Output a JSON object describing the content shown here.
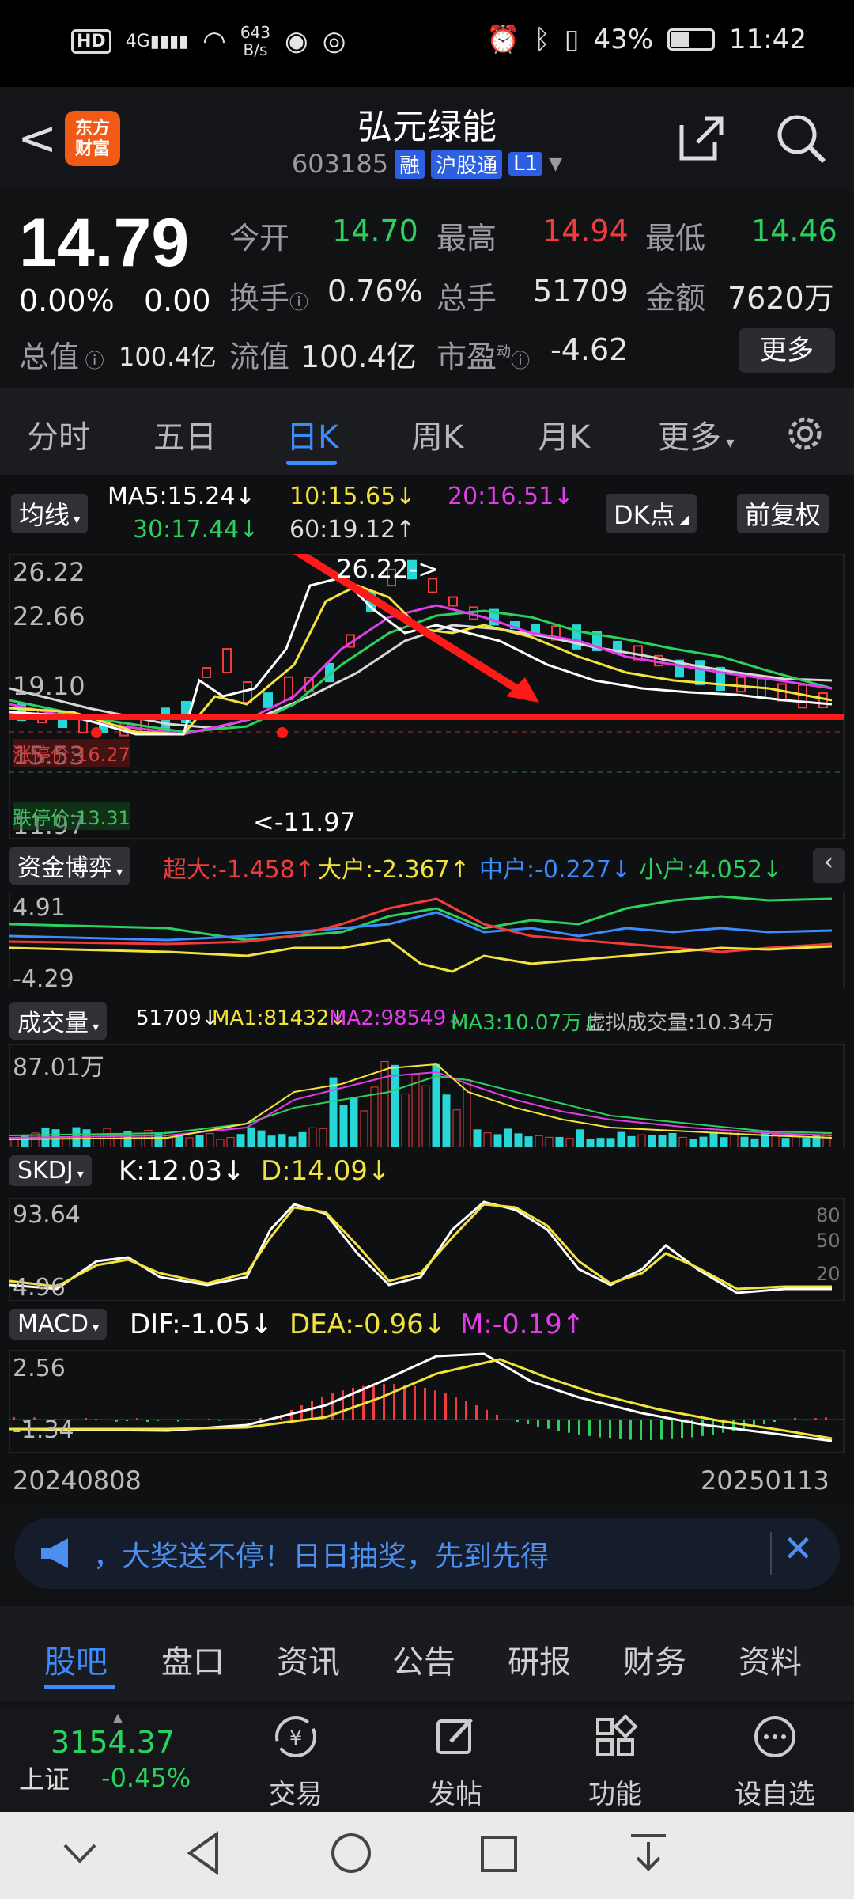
{
  "status": {
    "network": "4G",
    "speed_value": "643",
    "speed_unit": "B/s",
    "battery": "43%",
    "time": "11:42"
  },
  "header": {
    "back_label": "<",
    "logo_line1": "东方",
    "logo_line2": "财富",
    "title": "弘元绿能",
    "code": "603185",
    "tag_rong": "融",
    "tag_hgt": "沪股通",
    "tag_l1": "L1"
  },
  "quote": {
    "price": "14.79",
    "change_pct": "0.00%",
    "change": "0.00",
    "open_label": "今开",
    "open_value": "14.70",
    "high_label": "最高",
    "high_value": "14.94",
    "low_label": "最低",
    "low_value": "14.46",
    "turnover_label": "换手",
    "turnover_value": "0.76%",
    "volume_label": "总手",
    "volume_value": "51709",
    "amount_label": "金额",
    "amount_value": "7620万",
    "total_mv_label": "总值",
    "total_mv_value": "100.4亿",
    "float_mv_label": "流值",
    "float_mv_value": "100.4亿",
    "pe_label": "市盈",
    "pe_sup": "动",
    "pe_value": "-4.62",
    "more_label": "更多"
  },
  "tabs": {
    "items": [
      "分时",
      "五日",
      "日K",
      "周K",
      "月K",
      "更多"
    ],
    "active": "日K"
  },
  "kline": {
    "indicator_label": "均线",
    "ma5": "MA5:15.24↓",
    "ma10": "10:15.65↓",
    "ma20": "20:16.51↓",
    "ma30": "30:17.44↓",
    "ma60": "60:19.12↑",
    "dk_label": "DK点",
    "restore_label": "前复权",
    "y_top": "26.22",
    "y_mid1": "22.66",
    "y_mid2": "19.10",
    "y_low": "15.53",
    "y_bottom": "11.97",
    "high_marker": "26.22->",
    "low_marker": "<-11.97",
    "limit_up": "涨停价:16.27",
    "limit_down": "跌停价:13.31",
    "colors": {
      "ma5": "#ffffff",
      "ma10": "#f2e33c",
      "ma20": "#e23ee8",
      "ma30": "#2bd05e",
      "ma60": "#d8d8d8",
      "up": "#f03c3c",
      "down": "#27d6d6",
      "annotation": "#ff1a1a"
    }
  },
  "fund": {
    "label": "资金博弈",
    "super_large": "超大:-1.458↑",
    "large": "大户:-2.367↑",
    "medium": "中户:-0.227↓",
    "small": "小户:4.052↓",
    "y_top": "4.91",
    "y_bottom": "-4.29"
  },
  "volume": {
    "label": "成交量",
    "value": "51709↓",
    "ma1": "MA1:81432↓",
    "ma2": "MA2:98549↓",
    "ma3": "MA3:10.07万↓",
    "virtual": "虚拟成交量:10.34万",
    "y_top": "87.01万"
  },
  "skdj": {
    "label": "SKDJ",
    "k": "K:12.03↓",
    "d": "D:14.09↓",
    "y_top": "93.64",
    "y_bottom": "4.96",
    "ref80": "80",
    "ref50": "50",
    "ref20": "20"
  },
  "macd": {
    "label": "MACD",
    "dif": "DIF:-1.05↓",
    "dea": "DEA:-0.96↓",
    "m": "M:-0.19↑",
    "y_top": "2.56",
    "y_bottom": "-1.34"
  },
  "dates": {
    "start": "20240808",
    "end": "20250113"
  },
  "banner": {
    "text": "，大奖送不停！日日抽奖，先到先得"
  },
  "subtabs": {
    "items": [
      "股吧",
      "盘口",
      "资讯",
      "公告",
      "研报",
      "财务",
      "资料"
    ],
    "active": "股吧"
  },
  "bottomnav": {
    "index_value": "3154.37",
    "index_name": "上证",
    "index_change": "-0.45%",
    "trade": "交易",
    "post": "发帖",
    "func": "功能",
    "watch": "设自选"
  }
}
